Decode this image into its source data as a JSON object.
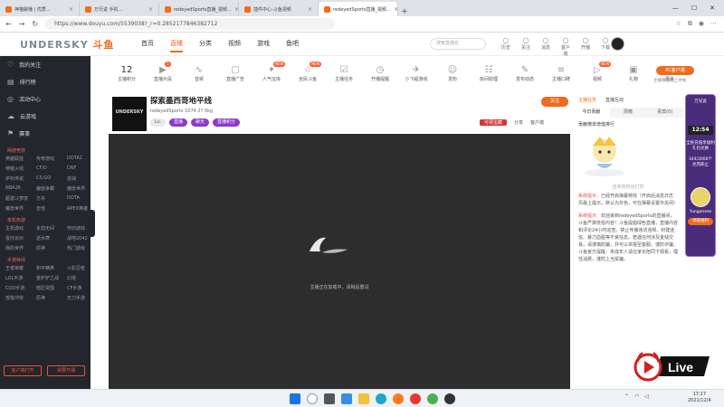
{
  "tabs": [
    {
      "label": "神猫聊播 | 优质...",
      "active": false
    },
    {
      "label": "万兄说 手机…",
      "active": false
    },
    {
      "label": "redeyedSports直播_视频…",
      "active": false
    },
    {
      "label": "插件中心-斗鱼视频",
      "active": false
    },
    {
      "label": "redeyedSports直播_视频…",
      "active": true
    }
  ],
  "address": {
    "url": "https://www.douyu.com/5539038?_r=0.2852177846382712"
  },
  "logo": {
    "text": "UNDERSKY",
    "mark": "斗鱼"
  },
  "topnav": {
    "items": [
      "首页",
      "直播",
      "分类",
      "视频",
      "游戏",
      "鱼吧"
    ],
    "search_placeholder": "搜索直播名",
    "icons": [
      {
        "icon": "history-icon",
        "label": "历史"
      },
      {
        "icon": "follow-icon",
        "label": "关注"
      },
      {
        "icon": "message-icon",
        "label": "消息"
      },
      {
        "icon": "upload-icon",
        "label": "客户端"
      },
      {
        "icon": "broadcast-icon",
        "label": "开播"
      },
      {
        "icon": "download-icon",
        "label": "下载"
      }
    ]
  },
  "sidebar": {
    "items": [
      {
        "icon": "follow-icon",
        "label": "我的关注"
      },
      {
        "icon": "rank-icon",
        "label": "排行榜"
      },
      {
        "icon": "activity-icon",
        "label": "活动中心"
      },
      {
        "icon": "cloud-icon",
        "label": "云游戏"
      },
      {
        "icon": "sports-icon",
        "label": "赛事"
      }
    ],
    "sections": [
      {
        "title": "网游竞技",
        "items": [
          "英雄联盟",
          "传奇游戏",
          "DOTA2",
          "穿越火线",
          "CF/D",
          "DNF",
          "炉石传说",
          "CS:GO",
          "逆战",
          "NBA2K",
          "魔兽争霸",
          "魔兽世界",
          "超激斗梦境",
          "方舟",
          "DOTA",
          "魔兽世界",
          "吉他",
          "APEX英雄"
        ]
      },
      {
        "title": "单机热游",
        "items": [
          "主机游戏",
          "永劫无间",
          "怀旧游戏",
          "蛋仔派对",
          "逆水寒",
          "战地2042",
          "我的世界",
          "原神",
          "热门游戏"
        ]
      },
      {
        "title": "手游休闲",
        "items": [
          "王者荣耀",
          "和平精英",
          "火影忍者",
          "LOL手游",
          "金铲铲之战",
          "幻塔",
          "COD手游",
          "暗区突围",
          "CF手游",
          "部落冲突",
          "原神",
          "天刀手游"
        ]
      }
    ],
    "buttons": [
      "客户端打开",
      "我要开播"
    ]
  },
  "categories": [
    {
      "icon": "count-icon",
      "label": "主播积分",
      "value": "12"
    },
    {
      "icon": "video-icon",
      "label": "直播片段",
      "badge": "1"
    },
    {
      "icon": "wave-icon",
      "label": "音频"
    },
    {
      "icon": "ad-icon",
      "label": "直播广告"
    },
    {
      "icon": "fire-icon",
      "label": "人气宝库",
      "badge": "NEW"
    },
    {
      "icon": "star-icon",
      "label": "全民斗鱼",
      "badge": "NEW"
    },
    {
      "icon": "task-icon",
      "label": "主播任务"
    },
    {
      "icon": "clock-icon",
      "label": "开播提醒"
    },
    {
      "icon": "game-icon",
      "label": "小飞船游戏"
    },
    {
      "icon": "people-icon",
      "label": "发粉"
    },
    {
      "icon": "team-icon",
      "label": "房间助理"
    },
    {
      "icon": "pencil-icon",
      "label": "发布动态"
    },
    {
      "icon": "list-icon",
      "label": "主播口碑"
    },
    {
      "icon": "play-icon",
      "label": "视频",
      "badge": "NEW"
    },
    {
      "icon": "box-icon",
      "label": "礼物"
    },
    {
      "icon": "more-icon",
      "label": "更多"
    }
  ],
  "pc": {
    "button": "PC客户端",
    "sub": "主播赚钱网上冲线"
  },
  "room": {
    "title": "探索墨西哥地平线",
    "meta": "redeyedSports  1074  2?.5kg",
    "tags": [
      "Lv.",
      "直播",
      "聊天",
      "直播积分"
    ],
    "follow": "关注",
    "right": [
      "可领宝藏",
      "分享",
      "客户端"
    ]
  },
  "player": {
    "message": "主播正在加载中，请稍后重试"
  },
  "chat": {
    "tabs": [
      "主播任务",
      "直播互动"
    ],
    "rank_tabs": [
      "今日贡献",
      "周榜",
      "贵宾(0)"
    ],
    "gift_title": "贡献榜单增值排行",
    "placeholder": "还未有粉丝打赏",
    "sys1": "已经开启弹幕特效（开启后消息日志页最上提示，默认为灰色，可在弹幕设置中关闭）",
    "sys_label": "系统提示：",
    "sys2": "欢迎来到redeyedSports的直播间，斗鱼严禁低俗内容！斗鱼提倡绿色直播，直播内容和评论24小时巡查。禁止传播违法违规、封建迷信、暴力血腥等不良信息。若遇任何涉及金钱交易，请谨慎防骗，并可以举报至客服，谨防诈骗。斗鱼官方提醒：未成年人请在家长陪同下观看，理性消费，谨防上当受骗。"
  },
  "promo": {
    "top": "万兄说",
    "time": "12:54",
    "l1": "全民充值享福利",
    "l2": "礼包兑换",
    "l3": "344/2000个",
    "l4": "兑完即止",
    "btn": "领取福利",
    "user": "Yunganese"
  },
  "live": {
    "text": "Live"
  },
  "taskbar": {
    "time": "17:17",
    "date": "2021/12/4"
  }
}
